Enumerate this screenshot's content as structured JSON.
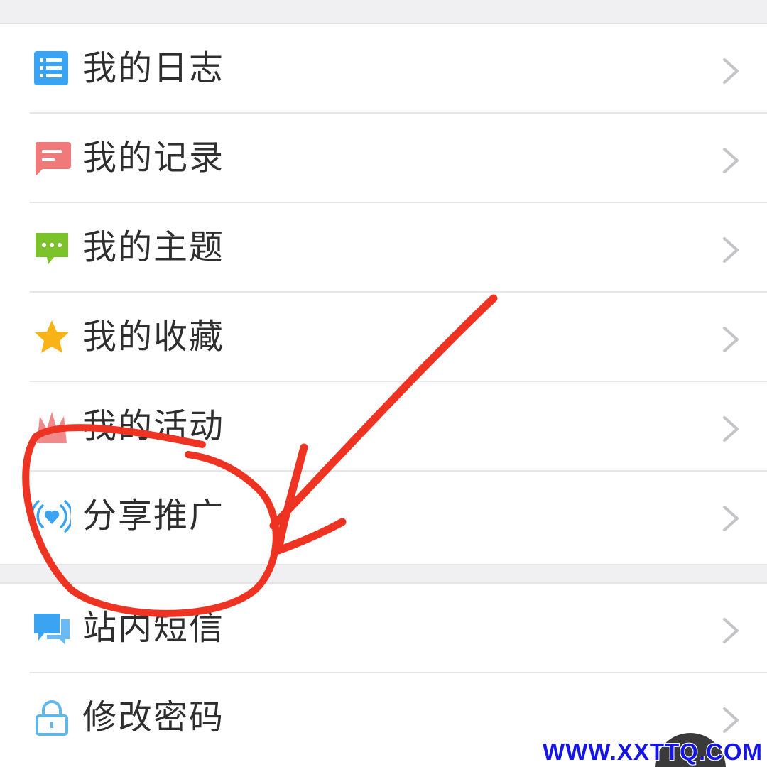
{
  "menu": {
    "group1": [
      {
        "label": "我的日志",
        "icon": "journal-icon",
        "color": "#3aa3f2"
      },
      {
        "label": "我的记录",
        "icon": "message-icon",
        "color": "#f07a7a"
      },
      {
        "label": "我的主题",
        "icon": "chat-dots-icon",
        "color": "#7cc32b"
      },
      {
        "label": "我的收藏",
        "icon": "star-icon",
        "color": "#f8b416"
      },
      {
        "label": "我的活动",
        "icon": "activity-icon",
        "color": "#f08a8a"
      },
      {
        "label": "分享推广",
        "icon": "broadcast-heart-icon",
        "color": "#3aa3f2"
      }
    ],
    "group2": [
      {
        "label": "站内短信",
        "icon": "chat-bubbles-icon",
        "color": "#3aa3f2"
      },
      {
        "label": "修改密码",
        "icon": "lock-icon",
        "color": "#5fb7e8"
      }
    ]
  },
  "annotation": {
    "color": "#ee3322"
  },
  "watermark": {
    "text": "WWW.XXTTQ.COM",
    "color": "#1515e6"
  }
}
